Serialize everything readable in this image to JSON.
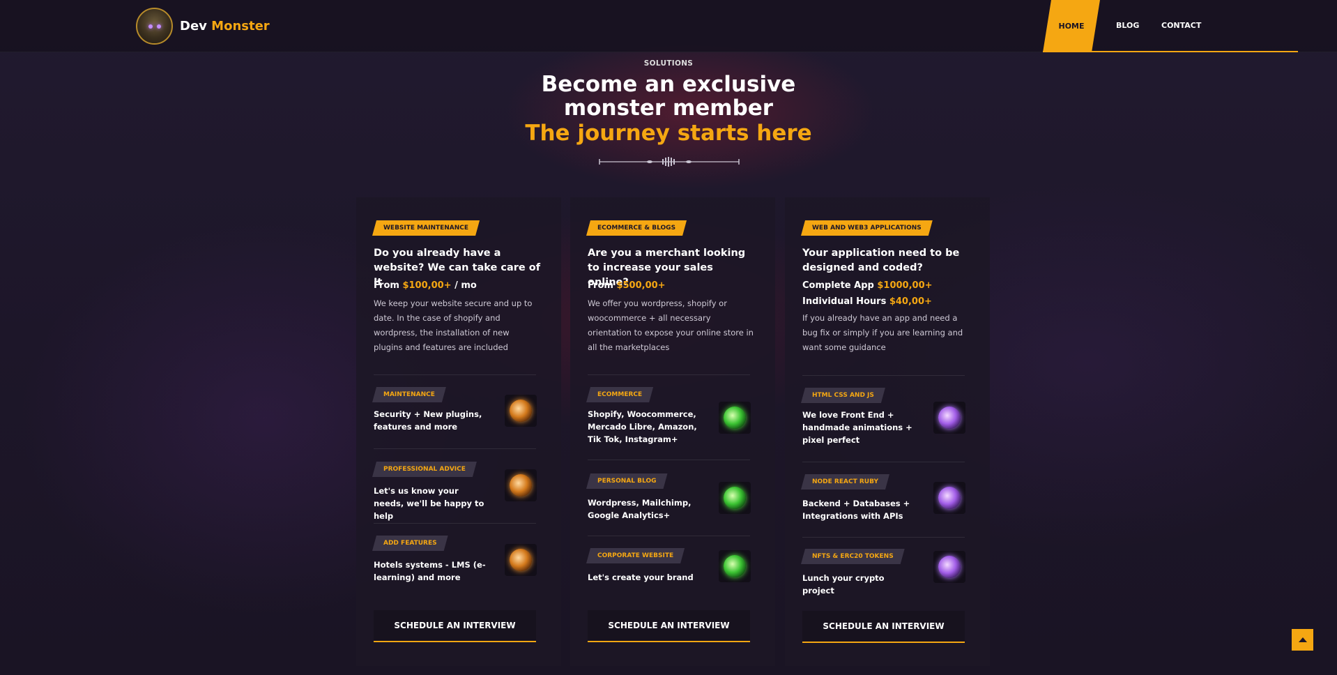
{
  "brand": {
    "name_a": "Dev",
    "name_b": "Monster",
    "accent": "#f5a712"
  },
  "nav": {
    "home": "HOME",
    "blog": "BLOG",
    "contact": "CONTACT"
  },
  "hero": {
    "eyebrow": "SOLUTIONS",
    "title_line1": "Become an exclusive",
    "title_line2": "monster member",
    "subtitle": "The journey starts here"
  },
  "cards": [
    {
      "tag": "WEBSITE MAINTENANCE",
      "heading": "Do you already have a website? We can take care of It",
      "price_prefix": "From ",
      "price_value": "$100,00+",
      "price_suffix": " / mo",
      "description": "We keep your website secure and up to date. In the case of shopify and wordpress, the installation of new plugins and features are included",
      "features": [
        {
          "tag": "MAINTENANCE",
          "text": "Security + New plugins, features and more",
          "icon": "gold-orb-icon"
        },
        {
          "tag": "PROFESSIONAL ADVICE",
          "text": "Let's us know your needs, we'll be happy to help",
          "icon": "gold-orb-icon"
        },
        {
          "tag": "ADD FEATURES",
          "text": "Hotels systems - LMS (e-learning) and more",
          "icon": "gold-orb-icon"
        }
      ],
      "button": "SCHEDULE AN INTERVIEW"
    },
    {
      "tag": "ECOMMERCE & BLOGS",
      "heading": "Are you a merchant looking to increase your sales online?",
      "price_prefix": "From ",
      "price_value": "$500,00+",
      "price_suffix": "",
      "description": "We offer you wordpress, shopify or woocommerce + all necessary orientation to expose your online store in all the marketplaces",
      "features": [
        {
          "tag": "ECOMMERCE",
          "text": "Shopify, Woocommerce, Mercado Libre, Amazon, Tik Tok, Instagram+",
          "icon": "green-orb-icon"
        },
        {
          "tag": "PERSONAL BLOG",
          "text": "Wordpress, Mailchimp, Google Analytics+",
          "icon": "green-orb-icon"
        },
        {
          "tag": "CORPORATE WEBSITE",
          "text": "Let's create your brand",
          "icon": "green-orb-icon"
        }
      ],
      "button": "SCHEDULE AN INTERVIEW"
    },
    {
      "tag": "WEB AND WEB3 APPLICATIONS",
      "heading": "Your application need to be designed and coded?",
      "price1_prefix": "Complete App ",
      "price1_value": "$1000,00+",
      "price2_prefix": "Individual Hours ",
      "price2_value": "$40,00+",
      "description": "If you already have an app and need a bug fix or simply if you are learning and want some guidance",
      "features": [
        {
          "tag": "HTML CSS AND JS",
          "text": "We love Front End + handmade animations + pixel perfect",
          "icon": "purple-orb-icon"
        },
        {
          "tag": "NODE REACT RUBY",
          "text": "Backend + Databases + Integrations with APIs",
          "icon": "purple-orb-icon"
        },
        {
          "tag": "NFTS & ERC20 TOKENS",
          "text": "Lunch your crypto project",
          "icon": "purple-orb-icon"
        }
      ],
      "button": "SCHEDULE AN INTERVIEW"
    }
  ],
  "scroll_top_icon": "arrow-up-icon"
}
